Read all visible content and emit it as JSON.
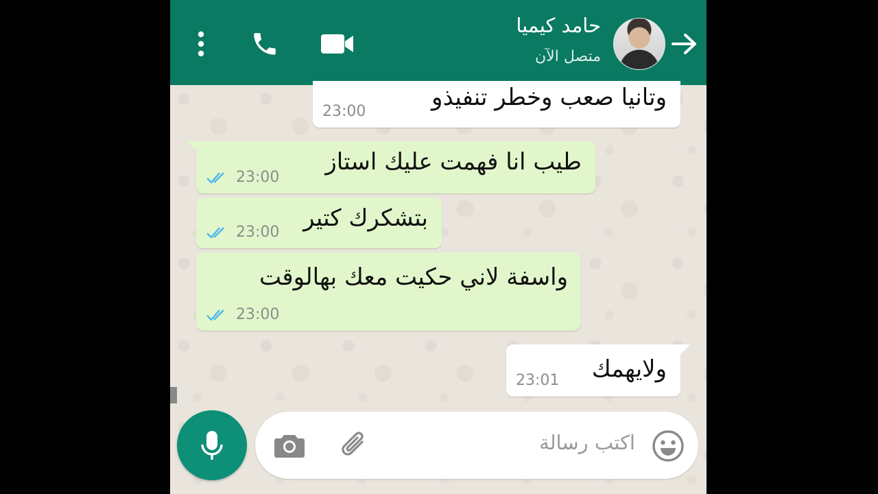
{
  "header": {
    "contact_name": "حامد كيميا",
    "status": "متصل الآن",
    "icons": [
      "more-vert-icon",
      "phone-icon",
      "video-camera-icon",
      "arrow-forward-icon"
    ],
    "color": "#0a7a62"
  },
  "messages": [
    {
      "direction": "incoming",
      "text": "وتانيا صعب وخطر تنفيذو",
      "time": "23:00"
    },
    {
      "direction": "outgoing",
      "text": "طيب انا فهمت عليك استاز",
      "time": "23:00",
      "read": true
    },
    {
      "direction": "outgoing",
      "text": "بتشكرك كتير",
      "time": "23:00",
      "read": true
    },
    {
      "direction": "outgoing",
      "text": "واسفة لاني حكيت معك بهالوقت",
      "time": "23:00",
      "read": true
    },
    {
      "direction": "incoming",
      "text": "ولايهمك",
      "time": "23:01"
    }
  ],
  "composer": {
    "placeholder": "اكتب رسالة",
    "icons": [
      "camera-icon",
      "attach-icon",
      "emoji-icon",
      "mic-icon"
    ],
    "mic_color": "#0e8f77"
  },
  "colors": {
    "incoming": "#ffffff",
    "outgoing": "#e1f7cb",
    "read_ticks": "#4fb6ec"
  }
}
